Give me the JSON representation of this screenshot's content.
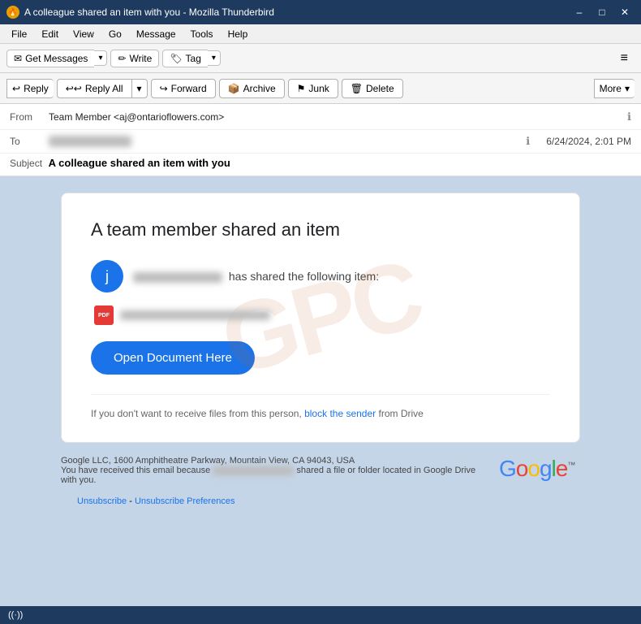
{
  "window": {
    "title": "A colleague shared an item with you - Mozilla Thunderbird",
    "icon": "🔥"
  },
  "titlebar": {
    "minimize": "–",
    "maximize": "□",
    "close": "✕"
  },
  "menubar": {
    "items": [
      "File",
      "Edit",
      "View",
      "Go",
      "Message",
      "Tools",
      "Help"
    ]
  },
  "toolbar": {
    "get_messages": "Get Messages",
    "write": "Write",
    "tag": "Tag",
    "menu_icon": "≡"
  },
  "action_toolbar": {
    "reply": "Reply",
    "reply_all": "Reply All",
    "forward": "Forward",
    "archive": "Archive",
    "junk": "Junk",
    "delete": "Delete",
    "more": "More"
  },
  "email_meta": {
    "from_label": "From",
    "from_value": "Team Member <aj@ontarioflowers.com>",
    "to_label": "To",
    "to_value": "████████████",
    "subject_label": "Subject",
    "subject_value": "A colleague shared an item with you",
    "date": "6/24/2024, 2:01 PM"
  },
  "email_body": {
    "card_title": "A team member shared an item",
    "avatar_letter": "j",
    "sharer_suffix": " has shared the following item:",
    "open_btn": "Open Document Here",
    "footer_prefix": "If you don't want to receive files from this person, ",
    "footer_link": "block the sender",
    "footer_suffix": " from Drive"
  },
  "company_footer": {
    "address": "Google LLC, 1600 Amphitheatre Parkway, Mountain View, CA 94043, USA",
    "notice_prefix": "You have received this email because ",
    "notice_suffix": " shared a file or folder located in Google Drive with you.",
    "logo": "Google",
    "tm": "™"
  },
  "unsubscribe": {
    "text1": "Unsubscribe",
    "separator": " - ",
    "text2": "Unsubscribe Preferences"
  },
  "statusbar": {
    "wifi": "((·))"
  }
}
